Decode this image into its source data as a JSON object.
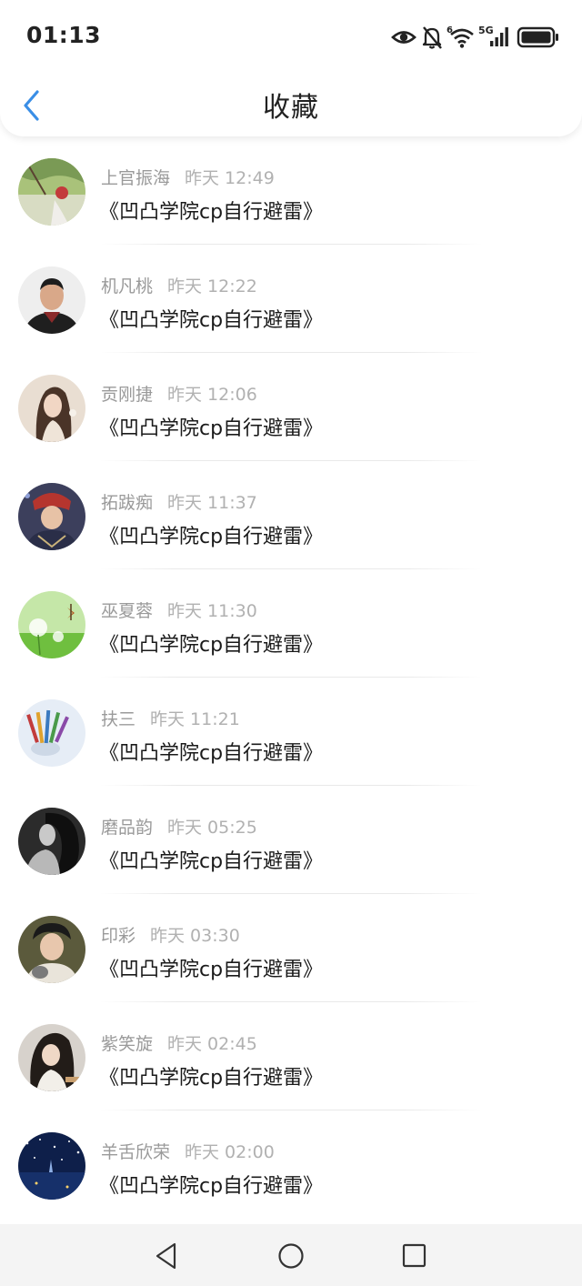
{
  "status_bar": {
    "time": "01:13",
    "network": "5G",
    "icons": [
      "eye-icon",
      "bell-muted-icon",
      "wifi-icon",
      "signal-icon",
      "battery-icon"
    ]
  },
  "header": {
    "title": "收藏",
    "back_icon": "chevron-left-icon",
    "accent_color": "#3a8ee6"
  },
  "items": [
    {
      "name": "上官振海",
      "time": "昨天 12:49",
      "message": "《凹凸学院cp自行避雷》"
    },
    {
      "name": "机凡桃",
      "time": "昨天 12:22",
      "message": "《凹凸学院cp自行避雷》"
    },
    {
      "name": "贡刚捷",
      "time": "昨天 12:06",
      "message": "《凹凸学院cp自行避雷》"
    },
    {
      "name": "拓跋痴",
      "time": "昨天 11:37",
      "message": "《凹凸学院cp自行避雷》"
    },
    {
      "name": "巫夏蓉",
      "time": "昨天 11:30",
      "message": "《凹凸学院cp自行避雷》"
    },
    {
      "name": "扶三",
      "time": "昨天 11:21",
      "message": "《凹凸学院cp自行避雷》"
    },
    {
      "name": "磨品韵",
      "time": "昨天 05:25",
      "message": "《凹凸学院cp自行避雷》"
    },
    {
      "name": "印彩",
      "time": "昨天 03:30",
      "message": "《凹凸学院cp自行避雷》"
    },
    {
      "name": "紫笑旋",
      "time": "昨天 02:45",
      "message": "《凹凸学院cp自行避雷》"
    },
    {
      "name": "羊舌欣荣",
      "time": "昨天 02:00",
      "message": "《凹凸学院cp自行避雷》"
    }
  ],
  "nav_bar": {
    "buttons": [
      "back-triangle-icon",
      "home-circle-icon",
      "recents-square-icon"
    ]
  }
}
